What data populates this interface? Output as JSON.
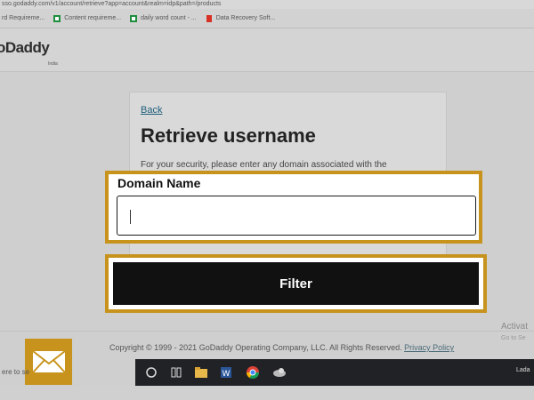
{
  "browser": {
    "url": "sso.godaddy.com/v1/account/retrieve?app=account&realm=idp&path=/products",
    "bookmarks": [
      {
        "label": "rd Requireme...",
        "icon": "doc-icon"
      },
      {
        "label": "Content requireme...",
        "icon": "sheet-icon"
      },
      {
        "label": "daily word count - ...",
        "icon": "sheet-icon"
      },
      {
        "label": "Data Recovery Soft...",
        "icon": "bookmark-icon"
      }
    ]
  },
  "header": {
    "logo": "oDaddy",
    "logo_sub": "India"
  },
  "card": {
    "back": "Back",
    "title": "Retrieve username",
    "description": "For your security, please enter any domain associated with the"
  },
  "form": {
    "label": "Domain Name",
    "value": "",
    "placeholder": ""
  },
  "filter_button": {
    "label": "Filter"
  },
  "footer": {
    "copyright": "Copyright © 1999 - 2021 GoDaddy Operating Company, LLC. All Rights Reserved.",
    "privacy_link": "Privacy Policy"
  },
  "watermark": {
    "line1": "Activat",
    "line2": "Go to Se"
  },
  "taskbar": {
    "search_text": "ere to se",
    "lang": "Lada",
    "icons": [
      "windows-search-icon",
      "task-view-icon",
      "file-explorer-icon",
      "word-icon",
      "chrome-icon",
      "app-icon"
    ]
  },
  "colors": {
    "highlight": "#c8931d",
    "button": "#111111",
    "link": "#1f5f7a"
  }
}
